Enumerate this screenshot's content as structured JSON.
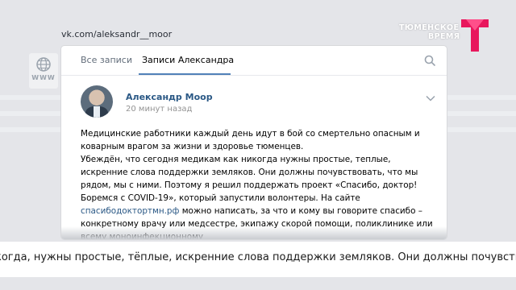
{
  "source_url": "vk.com/aleksandr__moor",
  "www_label": "WWW",
  "tabs": [
    {
      "label": "Все записи"
    },
    {
      "label": "Записи Александра"
    }
  ],
  "post": {
    "author": "Александр Моор",
    "time": "20 минут назад",
    "paragraphs": [
      "Медицинские работники каждый день идут в бой со смертельно опасным и коварным врагом за жизни и здоровье тюменцев.",
      "Убеждён, что сегодня медикам как никогда нужны простые, теплые, искренние слова поддержки земляков. Они должны почувствовать, что мы рядом, мы с ними. Поэтому я решил поддержать проект «Спасибо, доктор! Боремся с COVID-19», который запустили волонтеры. На сайте"
    ],
    "link_text": "спасибодоктортмн.рф",
    "after_link": " можно написать, за что и кому вы говорите спасибо – конкретному врачу или медсестре, экипажу скорой помощи, поликлинике или всему моноинфекционному"
  },
  "channel_logo": {
    "line1": "ТЮМЕНСКОЕ",
    "line2": "ВРЕМЯ",
    "color": "#e8175d"
  },
  "ticker": "когда, нужны простые, тёплые, искренние слова поддержки земляков. Они должны почувствовать, что мы рядом",
  "colors": {
    "link": "#2a5885",
    "accent": "#5181b8"
  }
}
